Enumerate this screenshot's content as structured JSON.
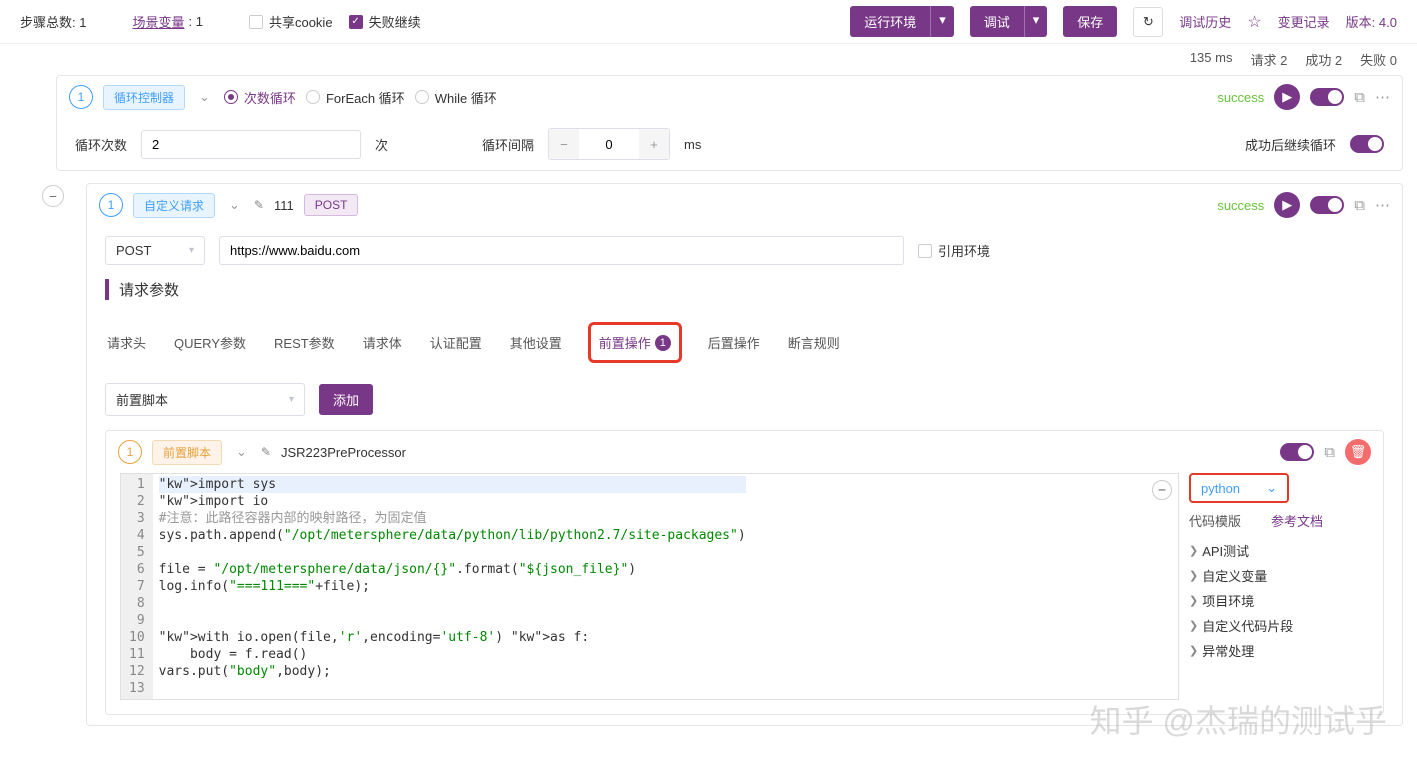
{
  "toolbar": {
    "steps_label": "步骤总数:",
    "steps_value": "1",
    "scene_vars_label": "场景变量",
    "scene_vars_value": ": 1",
    "share_cookie": "共享cookie",
    "fail_continue": "失败继续",
    "run_env": "运行环境",
    "debug": "调试",
    "save": "保存",
    "debug_history": "调试历史",
    "change_log": "变更记录",
    "version_label": "版本:",
    "version_value": "4.0"
  },
  "stats": {
    "time": "135 ms",
    "requests": "请求 2",
    "success": "成功 2",
    "fail": "失败 0"
  },
  "loop": {
    "step_num": "1",
    "title": "循环控制器",
    "radio_count": "次数循环",
    "radio_foreach": "ForEach 循环",
    "radio_while": "While 循环",
    "status": "success",
    "count_label": "循环次数",
    "count_value": "2",
    "count_unit": "次",
    "interval_label": "循环间隔",
    "interval_value": "0",
    "interval_unit": "ms",
    "continue_label": "成功后继续循环"
  },
  "request": {
    "step_num": "1",
    "type_tag": "自定义请求",
    "name": "111",
    "method_tag": "POST",
    "status": "success",
    "method": "POST",
    "url": "https://www.baidu.com",
    "ref_env": "引用环境",
    "section": "请求参数"
  },
  "tabs": {
    "headers": "请求头",
    "query": "QUERY参数",
    "rest": "REST参数",
    "body": "请求体",
    "auth": "认证配置",
    "other": "其他设置",
    "pre": "前置操作",
    "pre_badge": "1",
    "post": "后置操作",
    "assert": "断言规则"
  },
  "pre_action": {
    "select": "前置脚本",
    "add_btn": "添加"
  },
  "script": {
    "step_num": "1",
    "tag": "前置脚本",
    "name": "JSR223PreProcessor",
    "lines": [
      "import sys",
      "import io",
      "#注意：此路径容器内部的映射路径，为固定值",
      "sys.path.append(\"/opt/metersphere/data/python/lib/python2.7/site-packages\")",
      "",
      "file = \"/opt/metersphere/data/json/{}\".format(\"${json_file}\")",
      "log.info(\"===111===\"+file);",
      "",
      "",
      "with io.open(file,'r',encoding='utf-8') as f:",
      "    body = f.read()",
      "vars.put(\"body\",body);",
      ""
    ]
  },
  "side": {
    "lang": "python",
    "template_label": "代码模版",
    "doc_label": "参考文档",
    "tree": [
      "API测试",
      "自定义变量",
      "项目环境",
      "自定义代码片段",
      "异常处理"
    ]
  },
  "watermark": "知乎 @杰瑞的测试乎"
}
